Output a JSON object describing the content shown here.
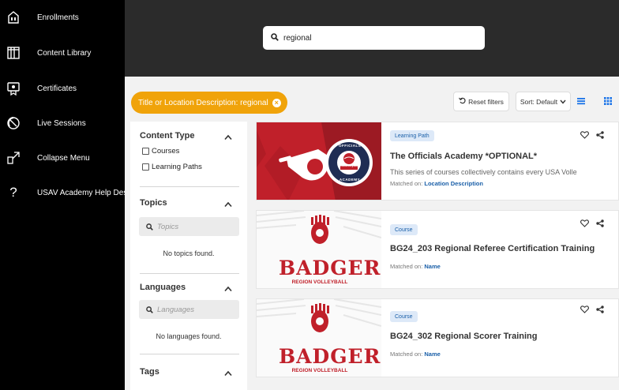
{
  "sidebar": {
    "items": [
      {
        "label": "Enrollments",
        "icon": "enrollments-icon"
      },
      {
        "label": "Content Library",
        "icon": "library-icon"
      },
      {
        "label": "Certificates",
        "icon": "certificate-icon"
      },
      {
        "label": "Live Sessions",
        "icon": "live-sessions-icon"
      },
      {
        "label": "Collapse Menu",
        "icon": "collapse-icon"
      },
      {
        "label": "USAV Academy Help Desk",
        "icon": "help-icon"
      }
    ]
  },
  "search": {
    "value": "regional",
    "icon": "search-icon"
  },
  "filter_chip": {
    "label": "Title or Location Description: regional",
    "remove": "×"
  },
  "toolbar": {
    "reset_label": "Reset filters",
    "sort_label": "Sort: Default",
    "list_view_icon": "list-view-icon",
    "grid_view_icon": "grid-view-icon"
  },
  "filters": {
    "content_type": {
      "heading": "Content Type",
      "options": [
        "Courses",
        "Learning Paths"
      ]
    },
    "topics": {
      "heading": "Topics",
      "placeholder": "Topics",
      "empty": "No topics found."
    },
    "languages": {
      "heading": "Languages",
      "placeholder": "Languages",
      "empty": "No languages found."
    },
    "tags": {
      "heading": "Tags"
    }
  },
  "cards": [
    {
      "badge": "Learning Path",
      "title": "The Officials Academy *OPTIONAL*",
      "description": "This series of courses collectively contains every USA Volle",
      "matched_prefix": "Matched on:",
      "matched_field": "Location Description",
      "thumb": {
        "logo_top": "OFFICIALS",
        "logo_bottom": "ACADEMY",
        "logo_mid": "USAVolleyball"
      }
    },
    {
      "badge": "Course",
      "title": "BG24_203 Regional Referee Certification Training",
      "description": "",
      "matched_prefix": "Matched on:",
      "matched_field": "Name",
      "thumb": {
        "brand": "BADGER",
        "sub": "REGION VOLLEYBALL"
      }
    },
    {
      "badge": "Course",
      "title": "BG24_302 Regional Scorer Training",
      "description": "",
      "matched_prefix": "Matched on:",
      "matched_field": "Name",
      "thumb": {
        "brand": "BADGER",
        "sub": "REGION VOLLEYBALL"
      }
    }
  ],
  "colors": {
    "accent_orange": "#f0a30a",
    "link_blue": "#1a5fa8",
    "brand_red": "#c0202a"
  }
}
